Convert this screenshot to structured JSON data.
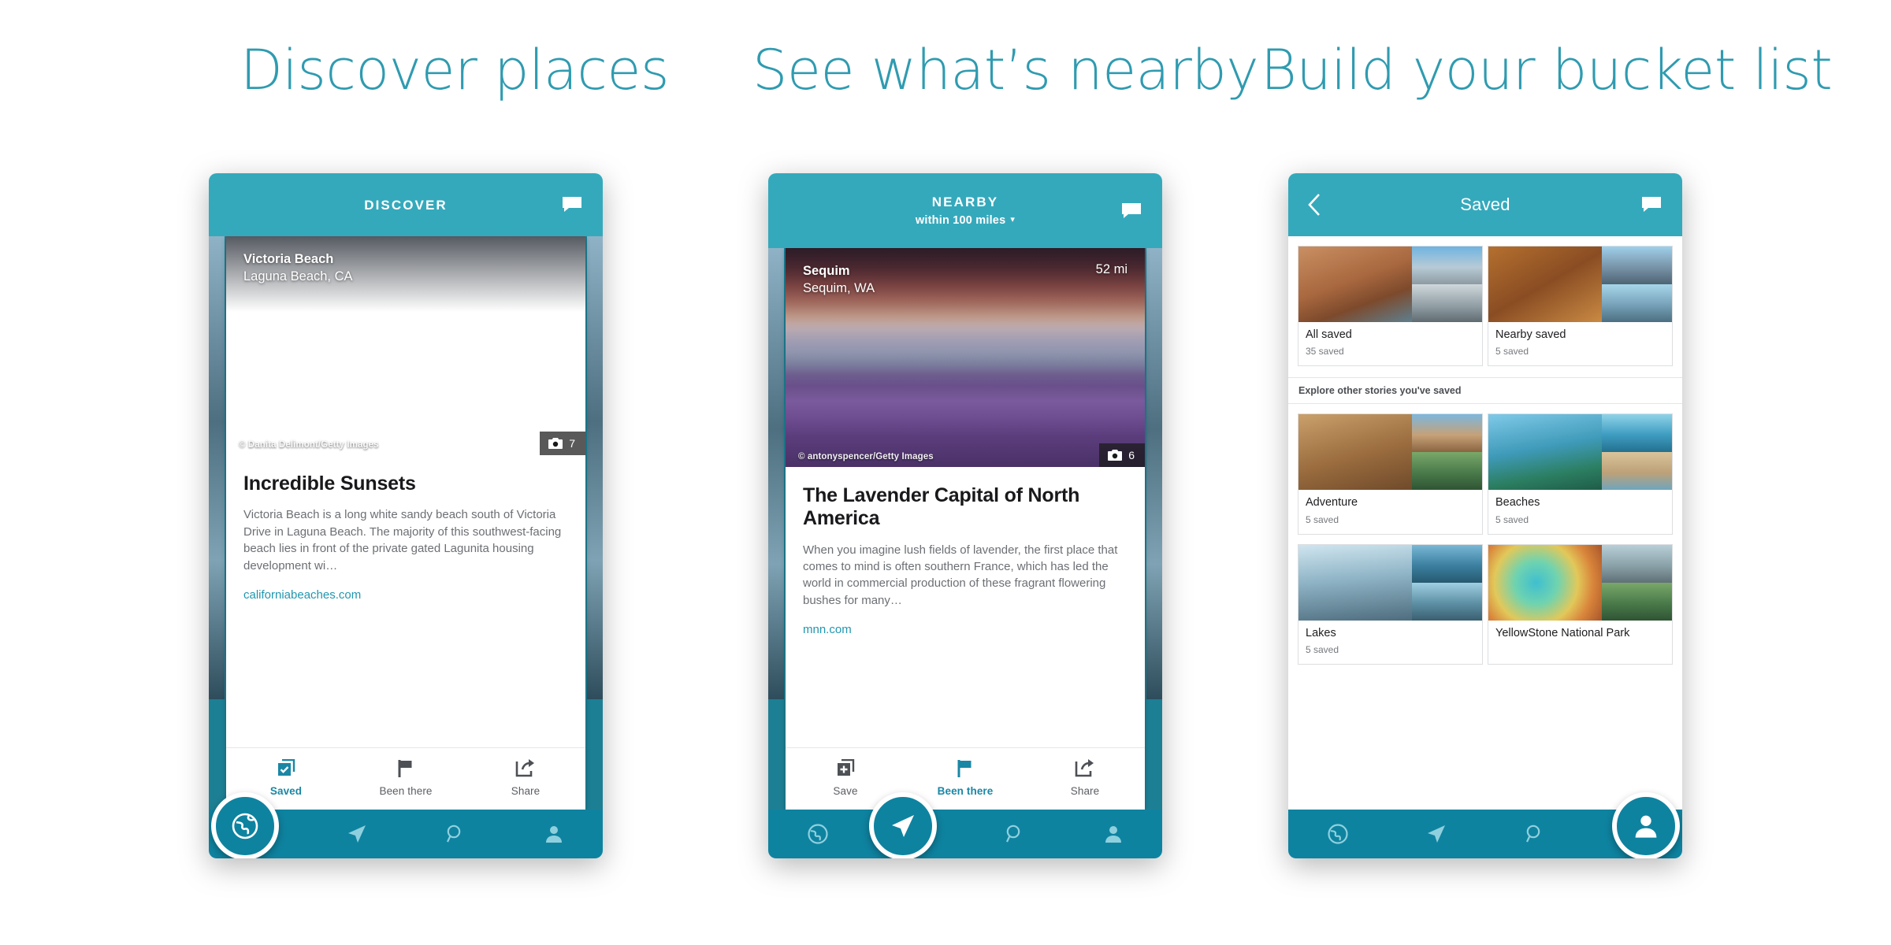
{
  "headlines": [
    {
      "text": "Discover places"
    },
    {
      "text": "See what’s nearby"
    },
    {
      "text": "Build your bucket list"
    }
  ],
  "colors": {
    "headline": "#2f9bb0",
    "topbar": "#35a9bc",
    "navbar": "#0e83a0",
    "accent": "#1a87a5",
    "link": "#2196b0"
  },
  "phones": [
    {
      "topbar": {
        "title": "DISCOVER",
        "subtitle": null,
        "chat_icon": "chat-bubble-icon"
      },
      "card": {
        "place": "Victoria Beach",
        "region": "Laguna Beach, CA",
        "distance": null,
        "credit": "© Danita Delimont/Getty Images",
        "photo_count": "7",
        "title": "Incredible Sunsets",
        "description": "Victoria Beach is a long white sandy beach south of Victoria Drive in Laguna Beach. The majority of this southwest-facing beach lies in front of the private gated Lagunita housing development wi…",
        "link": "californiabeaches.com",
        "actions": [
          {
            "label": "Saved",
            "icon": "save-checked-icon",
            "active": true
          },
          {
            "label": "Been there",
            "icon": "flag-icon",
            "active": false
          },
          {
            "label": "Share",
            "icon": "share-icon",
            "active": false
          }
        ]
      },
      "nav": {
        "active_index": 0,
        "items": [
          {
            "icon": "globe-icon"
          },
          {
            "icon": "navigate-arrow-icon"
          },
          {
            "icon": "search-icon"
          },
          {
            "icon": "person-icon"
          }
        ]
      }
    },
    {
      "topbar": {
        "title": "NEARBY",
        "subtitle": "within 100 miles",
        "subtitle_caret": "▾",
        "chat_icon": "chat-bubble-icon"
      },
      "card": {
        "place": "Sequim",
        "region": "Sequim, WA",
        "distance": "52 mi",
        "credit": "© antonyspencer/Getty Images",
        "photo_count": "6",
        "title": "The Lavender Capital of North America",
        "description": "When you imagine lush fields of lavender, the first place that comes to mind is often southern France, which has led the world in commercial production of these fragrant flowering bushes for many…",
        "link": "mnn.com",
        "actions": [
          {
            "label": "Save",
            "icon": "save-plus-icon",
            "active": false
          },
          {
            "label": "Been there",
            "icon": "flag-icon",
            "active": true
          },
          {
            "label": "Share",
            "icon": "share-icon",
            "active": false
          }
        ]
      },
      "nav": {
        "active_index": 1,
        "items": [
          {
            "icon": "globe-icon"
          },
          {
            "icon": "navigate-arrow-icon"
          },
          {
            "icon": "search-icon"
          },
          {
            "icon": "person-icon"
          }
        ]
      }
    },
    {
      "topbar": {
        "title": "Saved",
        "back_icon": "back-chevron-icon",
        "chat_icon": "chat-bubble-icon"
      },
      "saved": {
        "section_label": "Explore other stories you've saved",
        "top_tiles": [
          {
            "name": "All saved",
            "count": "35 saved"
          },
          {
            "name": "Nearby saved",
            "count": "5 saved"
          }
        ],
        "tiles": [
          {
            "name": "Adventure",
            "count": "5 saved"
          },
          {
            "name": "Beaches",
            "count": "5 saved"
          },
          {
            "name": "Lakes",
            "count": "5 saved"
          },
          {
            "name": "YellowStone National Park",
            "count": ""
          }
        ]
      },
      "nav": {
        "active_index": 3,
        "items": [
          {
            "icon": "globe-icon"
          },
          {
            "icon": "navigate-arrow-icon"
          },
          {
            "icon": "search-icon"
          },
          {
            "icon": "person-icon"
          }
        ]
      }
    }
  ]
}
